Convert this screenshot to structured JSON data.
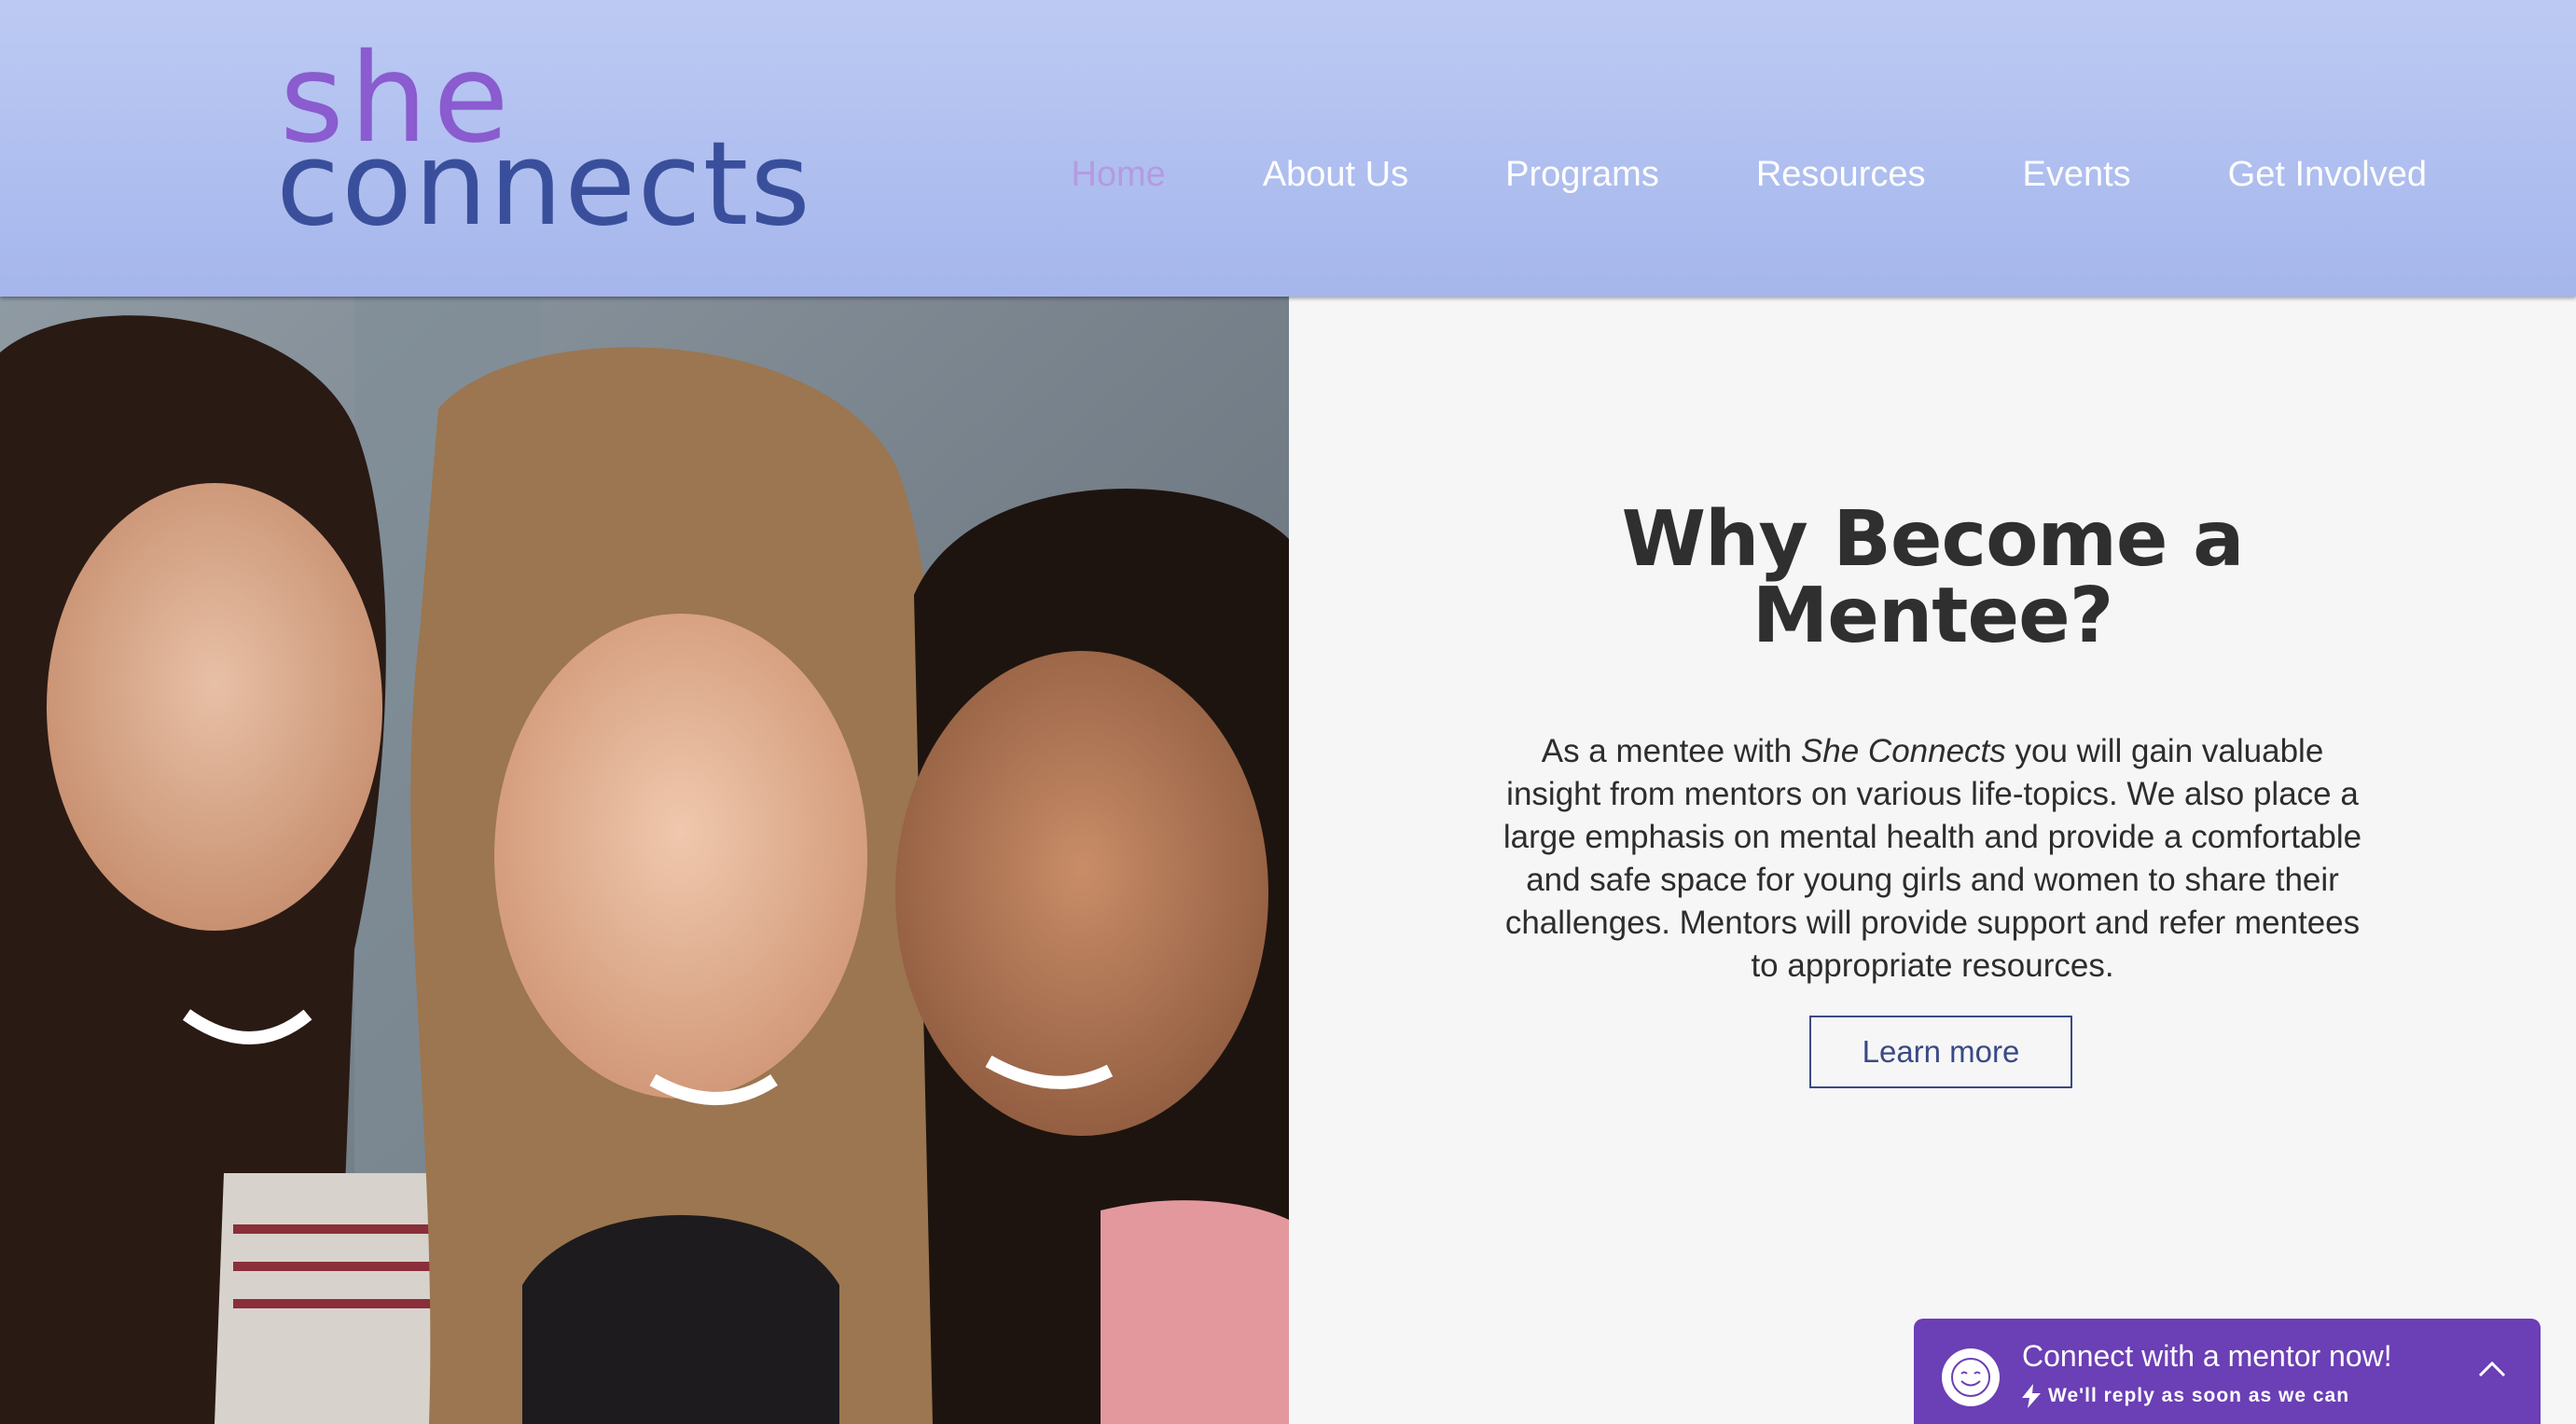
{
  "header": {
    "logo_top": "she",
    "logo_bottom": "connects",
    "nav": [
      {
        "label": "Home",
        "active": true
      },
      {
        "label": "About Us"
      },
      {
        "label": "Programs"
      },
      {
        "label": "Resources"
      },
      {
        "label": "Events"
      },
      {
        "label": "Get Involved"
      }
    ]
  },
  "main": {
    "title_line1": "Why Become a",
    "title_line2": "Mentee?",
    "body_before": "As a mentee with ",
    "body_italic": "She Connects",
    "body_after": " you will gain valuable insight from mentors on various life-topics. We also place a large emphasis on mental health and provide a comfortable and safe space for young girls and women to share their challenges. Mentors will provide support and refer mentees to appropriate resources.",
    "cta": "Learn more"
  },
  "chat": {
    "title": "Connect with a mentor now!",
    "subtitle": "We'll reply as soon as we can",
    "icon": "smiley-icon",
    "expand_icon": "chevron-up-icon"
  },
  "colors": {
    "header_top": "#bccaf3",
    "header_bottom": "#a5b6ec",
    "logo_purple": "#8a5ccf",
    "logo_blue": "#3a4f9c",
    "nav_active": "#b49be0",
    "chat_bg": "#6b3fb5"
  }
}
